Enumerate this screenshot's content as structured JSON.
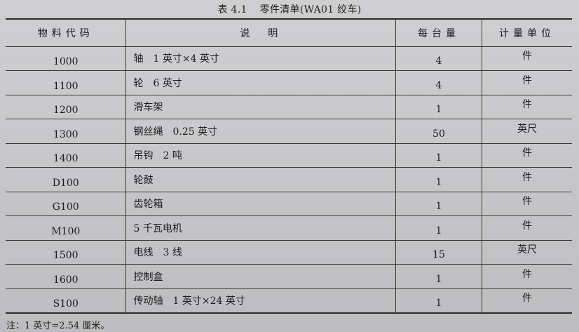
{
  "caption": {
    "number": "表 4.1",
    "title": "零件清单(WA01 绞车)"
  },
  "table": {
    "headers": {
      "code": "物料代码",
      "description": "说　明",
      "quantity": "每台量",
      "unit": "计量单位"
    },
    "rows": [
      {
        "code": "1000",
        "description": "轴　1 英寸×4 英寸",
        "quantity": "4",
        "unit": "件"
      },
      {
        "code": "1100",
        "description": "轮　6 英寸",
        "quantity": "4",
        "unit": "件"
      },
      {
        "code": "1200",
        "description": "滑车架",
        "quantity": "1",
        "unit": "件"
      },
      {
        "code": "1300",
        "description": "钢丝绳　0.25 英寸",
        "quantity": "50",
        "unit": "英尺"
      },
      {
        "code": "1400",
        "description": "吊钩　2 吨",
        "quantity": "1",
        "unit": "件"
      },
      {
        "code": "D100",
        "description": "轮鼓",
        "quantity": "1",
        "unit": "件"
      },
      {
        "code": "G100",
        "description": "齿轮箱",
        "quantity": "1",
        "unit": "件"
      },
      {
        "code": "M100",
        "description": "5 千瓦电机",
        "quantity": "1",
        "unit": "件"
      },
      {
        "code": "1500",
        "description": "电线　3 线",
        "quantity": "15",
        "unit": "英尺"
      },
      {
        "code": "1600",
        "description": "控制盒",
        "quantity": "1",
        "unit": "件"
      },
      {
        "code": "S100",
        "description": "传动轴　1 英寸×24 英寸",
        "quantity": "1",
        "unit": "件"
      }
    ]
  },
  "note": "注：1 英寸=2.54 厘米。"
}
